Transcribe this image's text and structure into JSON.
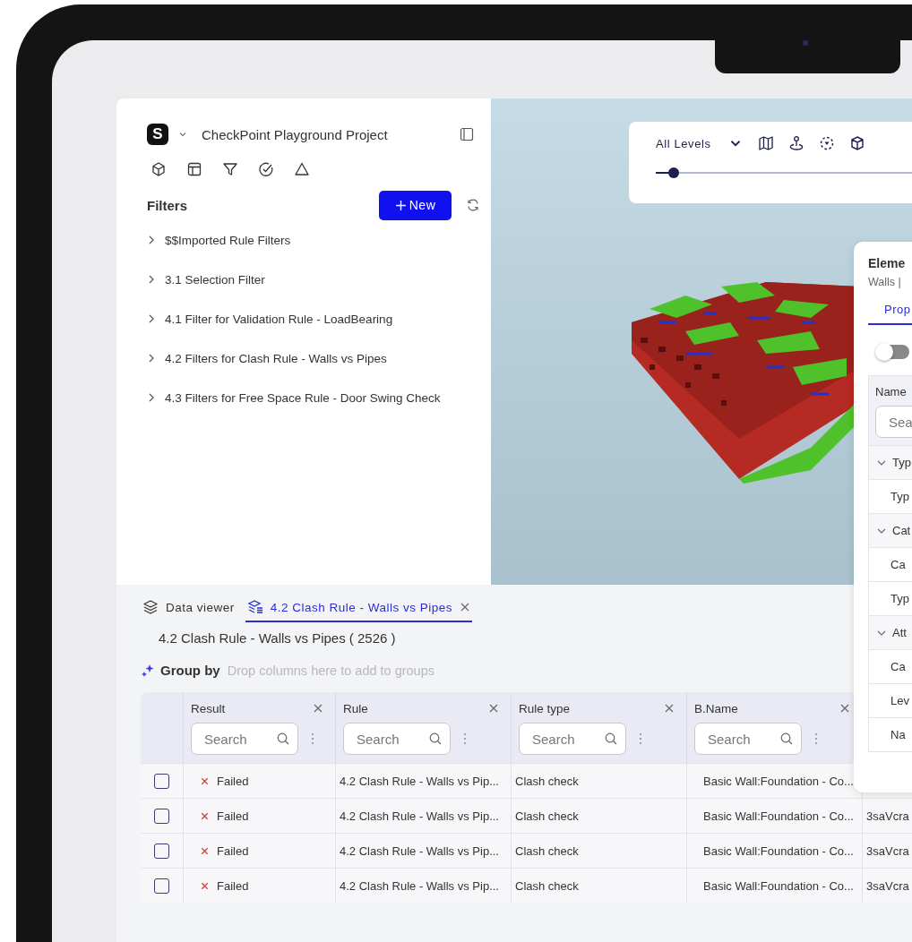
{
  "project": {
    "logo_letter": "S",
    "title": "CheckPoint Playground Project"
  },
  "toolbar_icons": [
    {
      "kind": "model"
    },
    {
      "kind": "layout"
    },
    {
      "kind": "filter"
    },
    {
      "kind": "check"
    },
    {
      "kind": "warning"
    }
  ],
  "filters": {
    "title": "Filters",
    "new_button": "New",
    "items": [
      {
        "label": "$$Imported Rule Filters",
        "expanded": false
      },
      {
        "label": "3.1 Selection Filter",
        "expanded": false
      },
      {
        "label": "4.1 Filter for Validation Rule - LoadBearing",
        "expanded": false
      },
      {
        "label": "4.2 Filters for Clash Rule - Walls vs Pipes",
        "expanded": false
      },
      {
        "label": "4.3 Filters for Free Space Rule - Door Swing Check",
        "expanded": false
      }
    ]
  },
  "viewer_toolbar": {
    "level_select": "All Levels",
    "slider": {
      "level": 0.06
    }
  },
  "element_panel": {
    "title": "Eleme",
    "subtitle": "Walls |",
    "tabs": [
      {
        "label": "Prop",
        "selected": true
      }
    ],
    "toggle": {
      "on": false
    },
    "column": "Name",
    "search": {
      "placeholder": "Sea"
    },
    "tree": [
      {
        "label": "Typ",
        "expanded": true,
        "children": [
          {
            "label": "Typ"
          }
        ]
      },
      {
        "label": "Cat",
        "expanded": true,
        "children": [
          {
            "label": "Ca"
          },
          {
            "label": "Typ"
          }
        ]
      },
      {
        "label": "Att",
        "expanded": true,
        "children": [
          {
            "label": "Ca"
          },
          {
            "label": "Lev"
          },
          {
            "label": "Na"
          }
        ]
      }
    ]
  },
  "data_tabs": [
    {
      "kind": "viewer",
      "label": "Data viewer",
      "selected": false,
      "closable": false
    },
    {
      "kind": "rule",
      "label": "4.2 Clash Rule - Walls vs Pipes",
      "selected": true,
      "closable": true
    }
  ],
  "result_title": "4.2 Clash Rule - Walls vs Pipes ( 2526 )",
  "group_by": {
    "label": "Group by",
    "hint": "Drop columns here to add to groups"
  },
  "table": {
    "columns": [
      {
        "label": "Result",
        "placeholder": "Search"
      },
      {
        "label": "Rule",
        "placeholder": "Search"
      },
      {
        "label": "Rule type",
        "placeholder": "Search"
      },
      {
        "label": "B.Name",
        "placeholder": "Search"
      }
    ],
    "rows": [
      {
        "checked": false,
        "result": {
          "failed": true,
          "label": "Failed"
        },
        "rule": "4.2 Clash Rule - Walls vs Pip...",
        "rule_type": "Clash check",
        "b_name": "Basic Wall:Foundation - Co..."
      },
      {
        "checked": false,
        "result": {
          "failed": true,
          "label": "Failed"
        },
        "rule": "4.2 Clash Rule - Walls vs Pip...",
        "rule_type": "Clash check",
        "b_name": "Basic Wall:Foundation - Co...",
        "column_5": "3saVcra"
      },
      {
        "checked": false,
        "result": {
          "failed": true,
          "label": "Failed"
        },
        "rule": "4.2 Clash Rule - Walls vs Pip...",
        "rule_type": "Clash check",
        "b_name": "Basic Wall:Foundation - Co...",
        "column_5": "3saVcra"
      },
      {
        "checked": false,
        "result": {
          "failed": true,
          "label": "Failed"
        },
        "rule": "4.2 Clash Rule - Walls vs Pip...",
        "rule_type": "Clash check",
        "b_name": "Basic Wall:Foundation - Co...",
        "column_5": "3saVcra"
      }
    ]
  }
}
